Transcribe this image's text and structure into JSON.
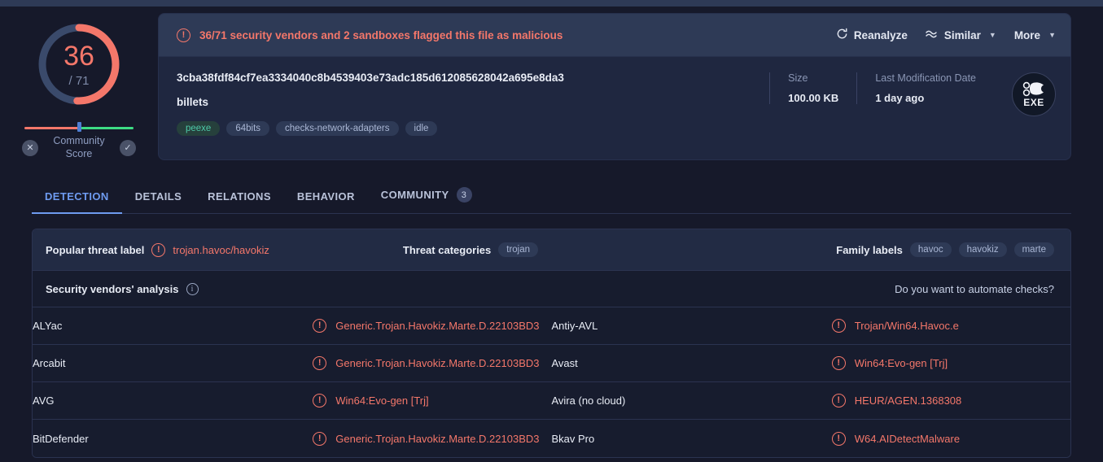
{
  "gauge": {
    "score": "36",
    "total": "/ 71",
    "detected": 36,
    "engines": 71,
    "color_detected": "#f4776a",
    "color_clean": "#3a4a6b"
  },
  "community": {
    "label_line1": "Community",
    "label_line2": "Score",
    "negative_icon": "close-icon",
    "positive_icon": "check-icon"
  },
  "alert": {
    "icon": "exclamation-circle-icon",
    "text": "36/71 security vendors and 2 sandboxes flagged this file as malicious",
    "color": "#f4776a"
  },
  "actions": {
    "reanalyze": {
      "label": "Reanalyze",
      "icon": "refresh-icon"
    },
    "similar": {
      "label": "Similar",
      "icon": "similar-icon",
      "caret": "⌄"
    },
    "more": {
      "label": "More",
      "caret": "⌄"
    }
  },
  "file": {
    "hash": "3cba38fdf84cf7ea3334040c8b4539403e73adc185d612085628042a695e8da3",
    "name": "billets",
    "tags": [
      {
        "label": "peexe",
        "style": "green"
      },
      {
        "label": "64bits",
        "style": "blue"
      },
      {
        "label": "checks-network-adapters",
        "style": "blue"
      },
      {
        "label": "idle",
        "style": "blue"
      }
    ],
    "meta": [
      {
        "label": "Size",
        "value": "100.00 KB"
      },
      {
        "label": "Last Modification Date",
        "value": "1 day ago"
      }
    ],
    "filetype": {
      "label": "EXE",
      "icon": "exe-gear-icon"
    }
  },
  "tabs": [
    {
      "label": "DETECTION",
      "active": true,
      "badge": ""
    },
    {
      "label": "DETAILS",
      "active": false,
      "badge": ""
    },
    {
      "label": "RELATIONS",
      "active": false,
      "badge": ""
    },
    {
      "label": "BEHAVIOR",
      "active": false,
      "badge": ""
    },
    {
      "label": "COMMUNITY",
      "active": false,
      "badge": "3"
    }
  ],
  "threat": {
    "popular_label_title": "Popular threat label",
    "popular_label_value": "trojan.havoc/havokiz",
    "popular_label_icon": "exclamation-circle-icon",
    "categories_title": "Threat categories",
    "categories": [
      "trojan"
    ],
    "family_title": "Family labels",
    "families": [
      "havoc",
      "havokiz",
      "marte"
    ]
  },
  "analysis": {
    "title": "Security vendors' analysis",
    "info_icon": "info-icon",
    "automate_link": "Do you want to automate checks?"
  },
  "vendors": [
    [
      {
        "name": "ALYac",
        "result": "Generic.Trojan.Havokiz.Marte.D.22103BD3",
        "icon": "exclamation-circle-icon"
      },
      {
        "name": "Antiy-AVL",
        "result": "Trojan/Win64.Havoc.e",
        "icon": "exclamation-circle-icon"
      }
    ],
    [
      {
        "name": "Arcabit",
        "result": "Generic.Trojan.Havokiz.Marte.D.22103BD3",
        "icon": "exclamation-circle-icon"
      },
      {
        "name": "Avast",
        "result": "Win64:Evo-gen [Trj]",
        "icon": "exclamation-circle-icon"
      }
    ],
    [
      {
        "name": "AVG",
        "result": "Win64:Evo-gen [Trj]",
        "icon": "exclamation-circle-icon"
      },
      {
        "name": "Avira (no cloud)",
        "result": "HEUR/AGEN.1368308",
        "icon": "exclamation-circle-icon"
      }
    ],
    [
      {
        "name": "BitDefender",
        "result": "Generic.Trojan.Havokiz.Marte.D.22103BD3",
        "icon": "exclamation-circle-icon"
      },
      {
        "name": "Bkav Pro",
        "result": "W64.AIDetectMalware",
        "icon": "exclamation-circle-icon"
      }
    ]
  ]
}
